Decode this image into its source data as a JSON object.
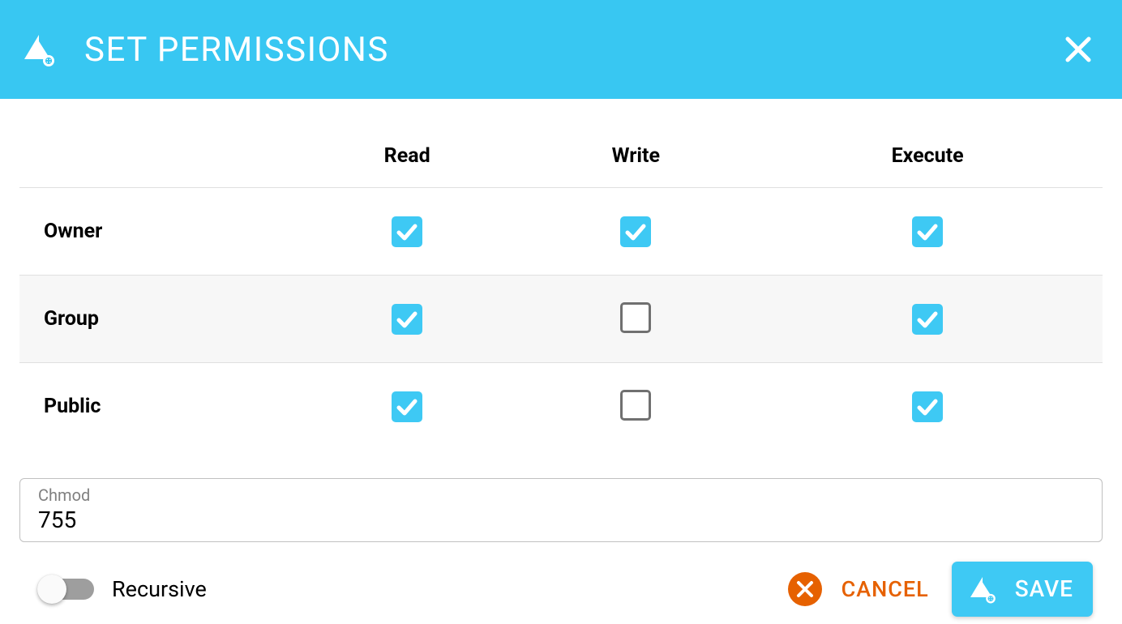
{
  "header": {
    "title": "SET PERMISSIONS"
  },
  "columns": {
    "read": "Read",
    "write": "Write",
    "execute": "Execute"
  },
  "rows": [
    {
      "label": "Owner",
      "read": true,
      "write": true,
      "execute": true
    },
    {
      "label": "Group",
      "read": true,
      "write": false,
      "execute": true
    },
    {
      "label": "Public",
      "read": true,
      "write": false,
      "execute": true
    }
  ],
  "chmod": {
    "label": "Chmod",
    "value": "755"
  },
  "recursive": {
    "label": "Recursive",
    "checked": false
  },
  "buttons": {
    "cancel": "CANCEL",
    "save": "SAVE"
  },
  "colors": {
    "accent": "#38c7f2",
    "warn": "#e66100"
  }
}
